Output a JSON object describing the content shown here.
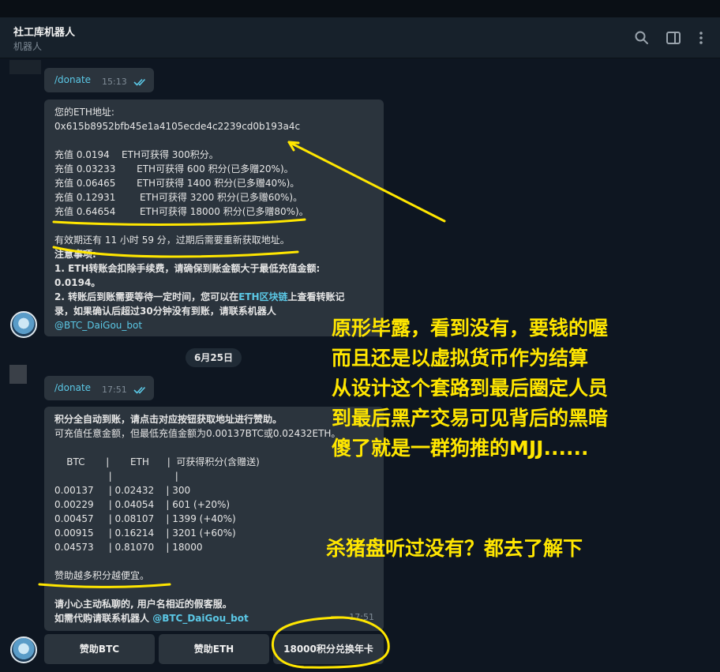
{
  "header": {
    "title": "社工库机器人",
    "subtitle": "机器人"
  },
  "messages": {
    "cmd1": {
      "text": "/donate",
      "time": "15:13"
    },
    "eth_address": {
      "label": "您的ETH地址:",
      "address": "0x615b8952bfb45e1a4105ecde4c2239cd0b193a4c",
      "rates": [
        "充值 0.0194    ETH可获得 300积分。",
        "充值 0.03233       ETH可获得 600 积分(已多赠20%)。",
        "充值 0.06465       ETH可获得 1400 积分(已多赠40%)。",
        "充值 0.12931        ETH可获得 3200 积分(已多赠60%)。",
        "充值 0.64654        ETH可获得 18000 积分(已多赠80%)。"
      ],
      "validity": "有效期还有 11 小时 59 分，过期后需要重新获取地址。",
      "notes_title": "注意事项:",
      "note1_a": "1. ETH转账会扣除手续费，请确保到账金额大于最低充值金额:",
      "note1_b": "0.0194。",
      "note2_a": "2. 转账后到账需要等待一定时间，您可以在",
      "note2_link": "ETH区块链",
      "note2_b": "上查看转账记",
      "note2_c": "录，如果确认后超过30分钟没有到账，请联系机器人",
      "note2_bot": "@BTC_DaiGou_bot"
    },
    "date_separator": "6月25日",
    "cmd2": {
      "text": "/donate",
      "time": "17:51"
    },
    "sponsor": {
      "line1": "积分全自动到账，请点击对应按钮获取地址进行赞助。",
      "line2": "可充值任意金额，但最低充值金额为0.00137BTC或0.02432ETH。",
      "table_header": "    BTC       |       ETH      |  可获得积分(含赠送)",
      "table_sep": "                  |                     |",
      "rows": [
        "0.00137     | 0.02432    | 300",
        "0.00229     | 0.04054    | 601 (+20%)",
        "0.00457     | 0.08107    | 1399 (+40%)",
        "0.00915     | 0.16214    | 3201 (+60%)",
        "0.04573     | 0.81070    | 18000"
      ],
      "cheaper": "赞助越多积分越便宜。",
      "warn1": "请小心主动私聊的, 用户名相近的假客服。",
      "warn2_a": "如需代购请联系机器人",
      "warn2_bot": "@BTC_DaiGou_bot",
      "time": "17:51"
    }
  },
  "keyboard": {
    "btn_btc": "赞助BTC",
    "btn_eth": "赞助ETH",
    "btn_card": "18000积分兑换年卡"
  },
  "annotations": {
    "block": [
      "原形毕露，看到没有，要钱的喔",
      "而且还是以虚拟货币作为结算",
      "从设计这个套路到最后圈定人员",
      "到最后黑产交易可见背后的黑暗",
      "傻了就是一群狗推的MJJ......"
    ],
    "bottom": "杀猪盘听过没有？都去了解下"
  },
  "colors": {
    "background": "#0e1621",
    "bubble": "#2b343d",
    "header": "#17212b",
    "link": "#5bc8e6",
    "annotation": "#ffe600"
  },
  "icons": [
    "search-icon",
    "sidebar-icon",
    "more-vertical-icon",
    "double-check-icon",
    "bot-avatar"
  ]
}
